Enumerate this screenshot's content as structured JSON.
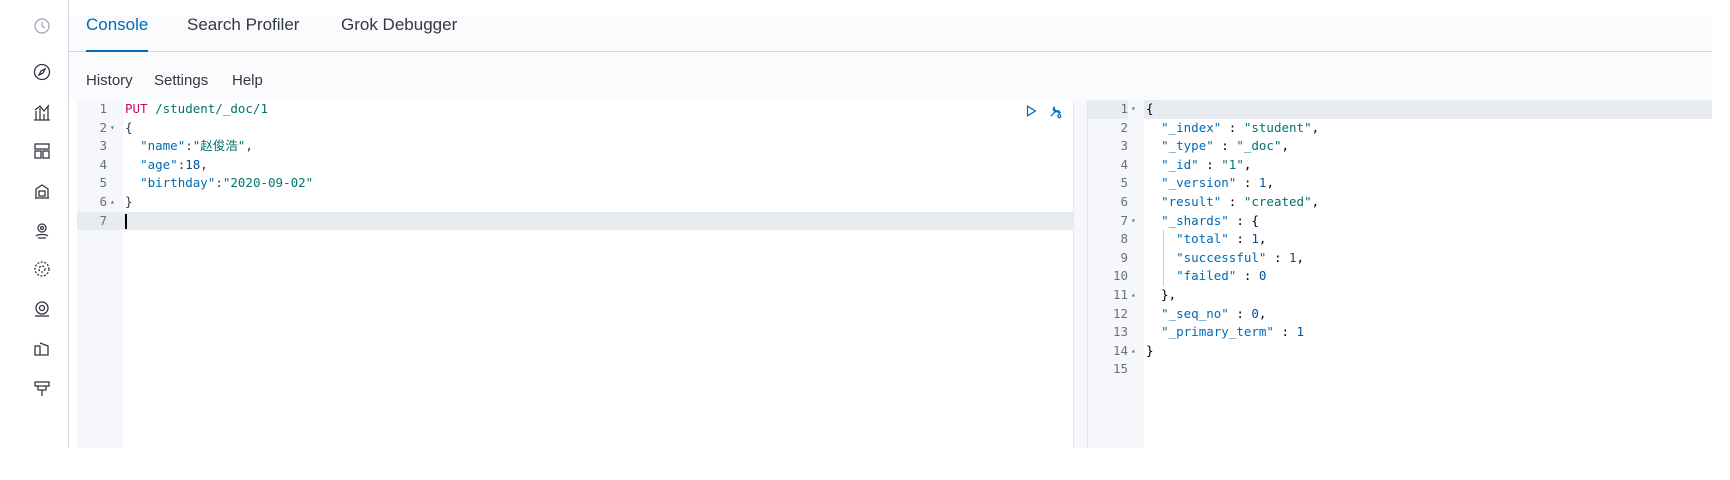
{
  "nav_rail": {
    "icons": [
      "clock-icon",
      "compass-icon",
      "visualize-icon",
      "dashboard-icon",
      "canvas-icon",
      "maps-icon",
      "ml-icon",
      "infrastructure-icon",
      "logs-icon",
      "apm-icon"
    ]
  },
  "tabs": [
    {
      "label": "Console"
    },
    {
      "label": "Search Profiler"
    },
    {
      "label": "Grok Debugger"
    }
  ],
  "submenu": [
    {
      "label": "History"
    },
    {
      "label": "Settings"
    },
    {
      "label": "Help"
    }
  ],
  "request": {
    "line_numbers": [
      "1",
      "2",
      "3",
      "4",
      "5",
      "6",
      "7"
    ],
    "method": "PUT",
    "path": " /student/_doc/1",
    "open_brace": "{",
    "name_key": "\"name\"",
    "name_value": "\"赵俊浩\"",
    "age_key": "\"age\"",
    "age_value": "18",
    "birthday_key": "\"birthday\"",
    "birthday_value": "\"2020-09-02\"",
    "close_brace": "}"
  },
  "response": {
    "line_numbers": [
      "1",
      "2",
      "3",
      "4",
      "5",
      "6",
      "7",
      "8",
      "9",
      "10",
      "11",
      "12",
      "13",
      "14",
      "15"
    ],
    "lines": [
      "{",
      "  \"_index\" : \"student\",",
      "  \"_type\" : \"_doc\",",
      "  \"_id\" : \"1\",",
      "  \"_version\" : 1,",
      "  \"result\" : \"created\",",
      "  \"_shards\" : {",
      "    \"total\" : 1,",
      "    \"successful\" : 1,",
      "    \"failed\" : 0",
      "  },",
      "  \"_seq_no\" : 0,",
      "  \"_primary_term\" : 1",
      "}",
      ""
    ]
  },
  "colors": {
    "accent": "#006bb4",
    "method": "#c80a68",
    "string": "#00756c"
  }
}
